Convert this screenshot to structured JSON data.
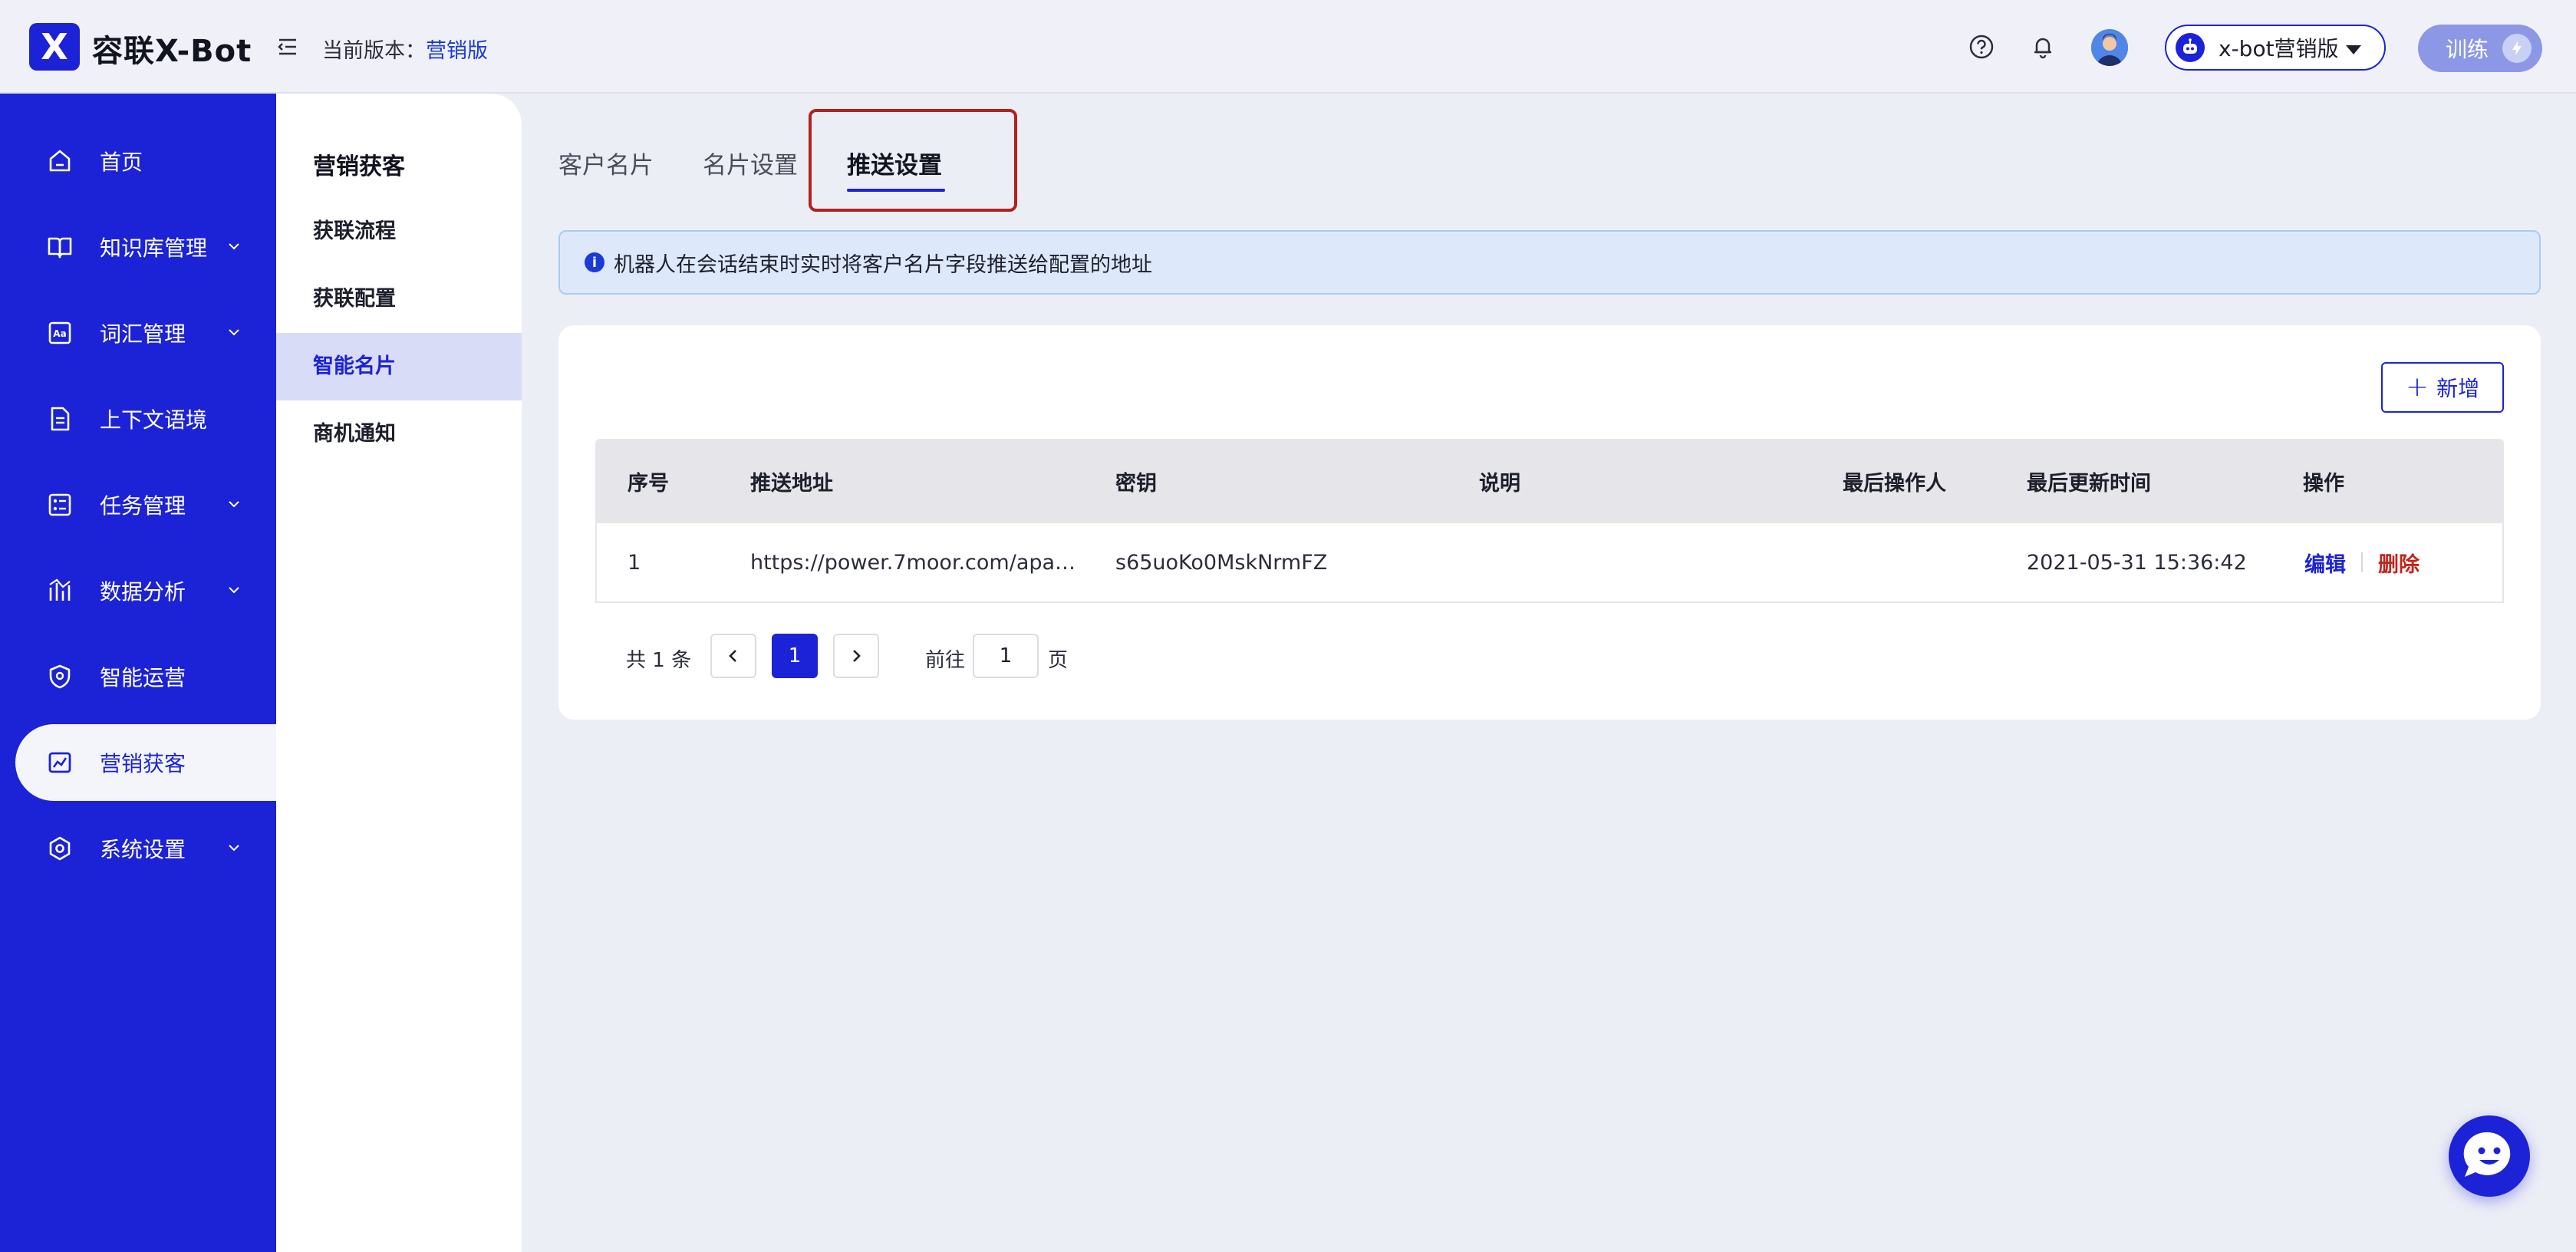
{
  "header": {
    "logo_mark": "X",
    "app_name": "容联X-Bot",
    "version_label": "当前版本：",
    "version_value": "营销版",
    "bot_name": "x-bot营销版",
    "train_label": "训练"
  },
  "sidebar": {
    "items": [
      {
        "label": "首页",
        "icon": "home-icon"
      },
      {
        "label": "知识库管理",
        "icon": "book-icon"
      },
      {
        "label": "词汇管理",
        "icon": "vocabulary-icon"
      },
      {
        "label": "上下文语境",
        "icon": "document-icon"
      },
      {
        "label": "任务管理",
        "icon": "task-icon"
      },
      {
        "label": "数据分析",
        "icon": "chart-icon"
      },
      {
        "label": "智能运营",
        "icon": "shield-icon"
      },
      {
        "label": "营销获客",
        "icon": "marketing-icon"
      },
      {
        "label": "系统设置",
        "icon": "gear-icon"
      }
    ],
    "active": "营销获客"
  },
  "subnav": {
    "title": "营销获客",
    "items": [
      "获联流程",
      "获联配置",
      "智能名片",
      "商机通知"
    ],
    "active": "智能名片"
  },
  "tabs": [
    "客户名片",
    "名片设置",
    "推送设置"
  ],
  "active_tab": "推送设置",
  "alert": {
    "text": "机器人在会话结束时实时将客户名片字段推送给配置的地址"
  },
  "toolbar": {
    "add_label": "新增"
  },
  "table": {
    "columns": [
      "序号",
      "推送地址",
      "密钥",
      "说明",
      "最后操作人",
      "最后更新时间",
      "操作"
    ],
    "rows": [
      {
        "index": "1",
        "url": "https://power.7moor.com/apa…",
        "key": "s65uoKo0MskNrmFZ",
        "description": "",
        "operator": "",
        "updated_at": "2021-05-31 15:36:42",
        "edit": "编辑",
        "delete": "删除"
      }
    ]
  },
  "pagination": {
    "total": "共 1 条",
    "current_page": "1",
    "goto_label": "前往",
    "goto_value": "1",
    "goto_suffix": "页"
  },
  "colors": {
    "brand": "#1c23d6",
    "danger": "#c0241d",
    "highlight_box": "#b4201c"
  }
}
